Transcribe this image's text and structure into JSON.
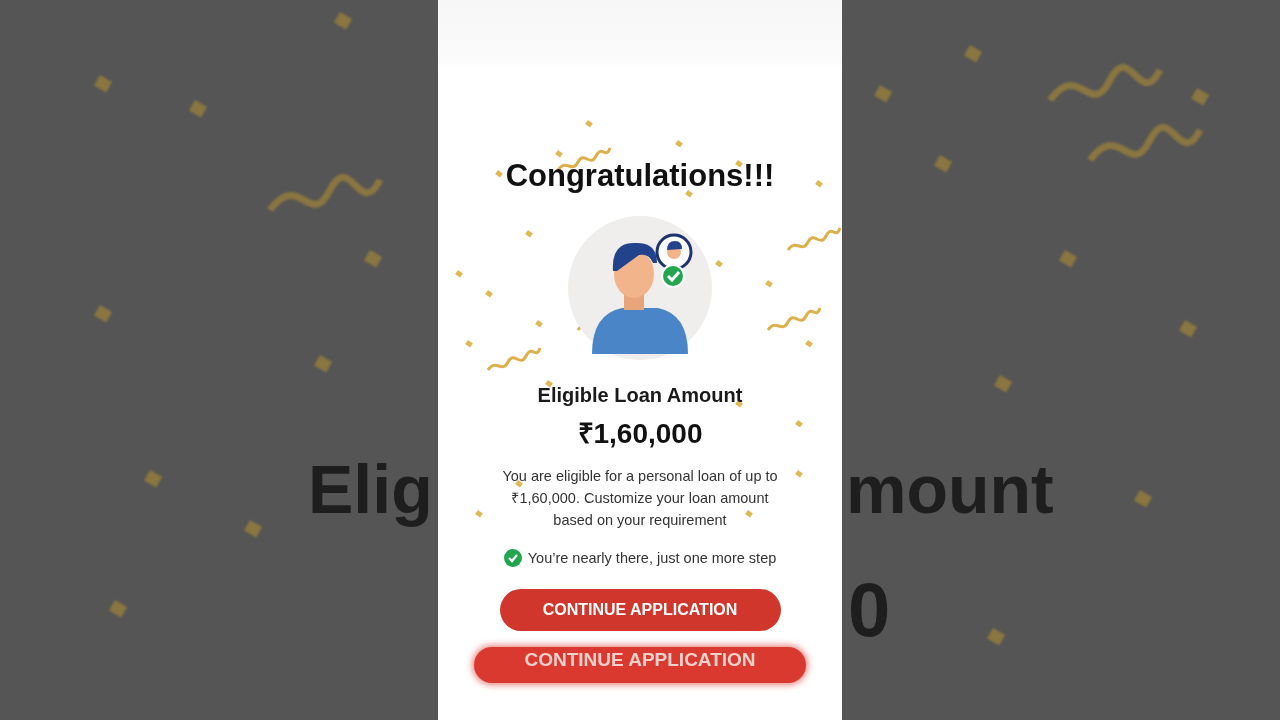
{
  "backdrop": {
    "texts": [
      "Elig",
      "mount",
      "0"
    ]
  },
  "screen": {
    "title": "Congratulations!!!",
    "heading": "Eligible Loan Amount",
    "amount": "₹1,60,000",
    "description": "You are eligible for a personal loan of up to ₹1,60,000. Customize your loan amount based on your requirement",
    "status": {
      "text": "You’re nearly there, just one more step",
      "done": true
    },
    "button": "CONTINUE APPLICATION",
    "blurred_button": "CONTINUE APPLICATION"
  }
}
